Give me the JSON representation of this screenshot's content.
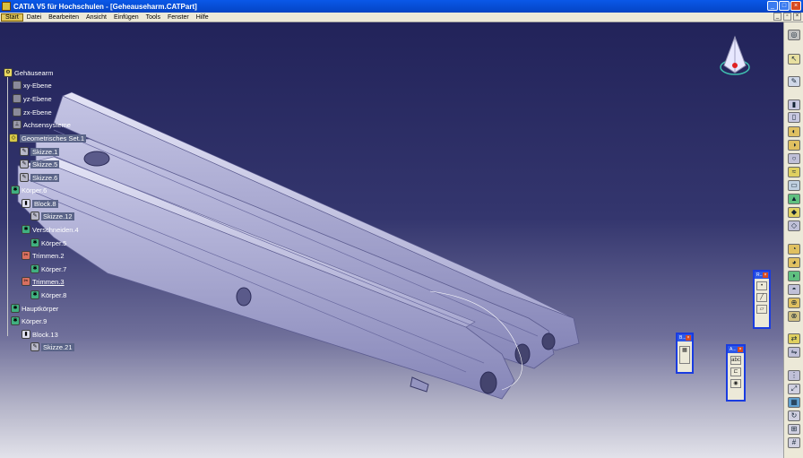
{
  "window": {
    "title": "CATIA V5 für Hochschulen - [Geheauseharm.CATPart]",
    "colors": {
      "titlebar": "#0454dc",
      "viewport_top": "#22235a",
      "viewport_bottom": "#e2e2ea",
      "part": "#c8c8e8"
    }
  },
  "menu": {
    "items": [
      "Start",
      "Datei",
      "Bearbeiten",
      "Ansicht",
      "Einfügen",
      "Tools",
      "Fenster",
      "Hilfe"
    ]
  },
  "tree": {
    "root": "Gehäusearm",
    "nodes": [
      {
        "label": "xy-Ebene",
        "icon": "plane-icon"
      },
      {
        "label": "yz-Ebene",
        "icon": "plane-icon"
      },
      {
        "label": "zx-Ebene",
        "icon": "plane-icon"
      },
      {
        "label": "Achsensysteme",
        "icon": "axis-system-icon"
      },
      {
        "label": "Geometrisches Set.1",
        "icon": "geometrical-set-icon"
      },
      {
        "label": "Skizze.1",
        "icon": "sketch-icon"
      },
      {
        "label": "Skizze.5",
        "icon": "sketch-icon"
      },
      {
        "label": "Skizze.6",
        "icon": "sketch-icon"
      },
      {
        "label": "Körper.6",
        "icon": "body-icon"
      },
      {
        "label": "Block.8",
        "icon": "pad-icon"
      },
      {
        "label": "Skizze.12",
        "icon": "sketch-icon"
      },
      {
        "label": "Verschneiden.4",
        "icon": "intersect-icon"
      },
      {
        "label": "Körper.5",
        "icon": "body-icon"
      },
      {
        "label": "Trimmen.2",
        "icon": "trim-icon"
      },
      {
        "label": "Körper.7",
        "icon": "body-icon"
      },
      {
        "label": "Trimmen.3",
        "icon": "trim-icon"
      },
      {
        "label": "Körper.8",
        "icon": "body-icon"
      },
      {
        "label": "Hauptkörper",
        "icon": "body-icon"
      },
      {
        "label": "Körper.9",
        "icon": "body-icon"
      },
      {
        "label": "Block.13",
        "icon": "pad-icon"
      },
      {
        "label": "Skizze.21",
        "icon": "sketch-icon"
      }
    ]
  },
  "floating_toolbars": [
    {
      "title": "R...",
      "icons": [
        "point-icon",
        "line-icon",
        "plane-icon"
      ]
    },
    {
      "title": "B...",
      "icons": [
        "boolean-icon"
      ]
    },
    {
      "title": "A...",
      "icons": [
        "abc-icon",
        "measure-icon",
        "material-icon"
      ]
    }
  ],
  "right_toolbar": {
    "icons": [
      "compass-icon",
      "select-icon",
      "sketcher-icon",
      "pad-icon",
      "pocket-icon",
      "shaft-icon",
      "groove-icon",
      "hole-icon",
      "rib-icon",
      "slot-icon",
      "stiffener-icon",
      "loft-icon",
      "remove-loft-icon",
      "fillet-icon",
      "chamfer-icon",
      "draft-icon",
      "shell-icon",
      "thickness-icon",
      "thread-icon",
      "translate-icon",
      "mirror-icon",
      "pattern-icon",
      "scale-icon",
      "boolean-icon",
      "update-icon",
      "measure-icon",
      "analysis-icon",
      "grid-icon"
    ]
  }
}
